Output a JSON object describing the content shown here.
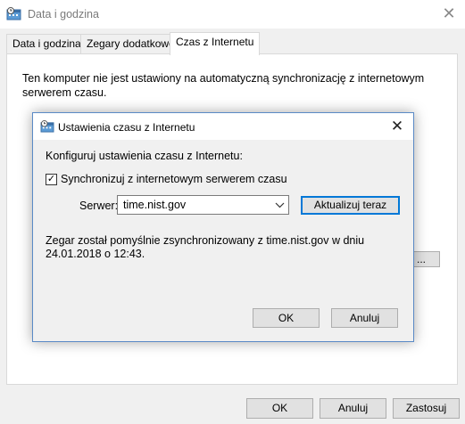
{
  "window": {
    "title": "Data i godzina"
  },
  "tabs": [
    {
      "label": "Data i godzina"
    },
    {
      "label": "Zegary dodatkowe"
    },
    {
      "label": "Czas z Internetu"
    }
  ],
  "panel": {
    "text": "Ten komputer nie jest ustawiony na automatyczną synchronizację z internetowym serwerem czasu.",
    "partial_button": "..."
  },
  "footer": {
    "ok": "OK",
    "cancel": "Anuluj",
    "apply": "Zastosuj"
  },
  "dialog": {
    "title": "Ustawienia czasu z Internetu",
    "heading": "Konfiguruj ustawienia czasu z Internetu:",
    "sync_checkbox": {
      "label": "Synchronizuj z internetowym serwerem czasu",
      "checked": true,
      "mark": "✓"
    },
    "server": {
      "label": "Serwer:",
      "value": "time.nist.gov"
    },
    "update_button": "Aktualizuj teraz",
    "status": "Zegar został pomyślnie zsynchronizowany z time.nist.gov w dniu 24.01.2018 o 12:43.",
    "ok": "OK",
    "cancel": "Anuluj"
  },
  "icons": {
    "window": "clock-calendar-icon",
    "close": "close-icon",
    "chevron": "chevron-down-icon"
  },
  "colors": {
    "accent": "#0078d7",
    "dialog_border": "#5a8ac6"
  }
}
